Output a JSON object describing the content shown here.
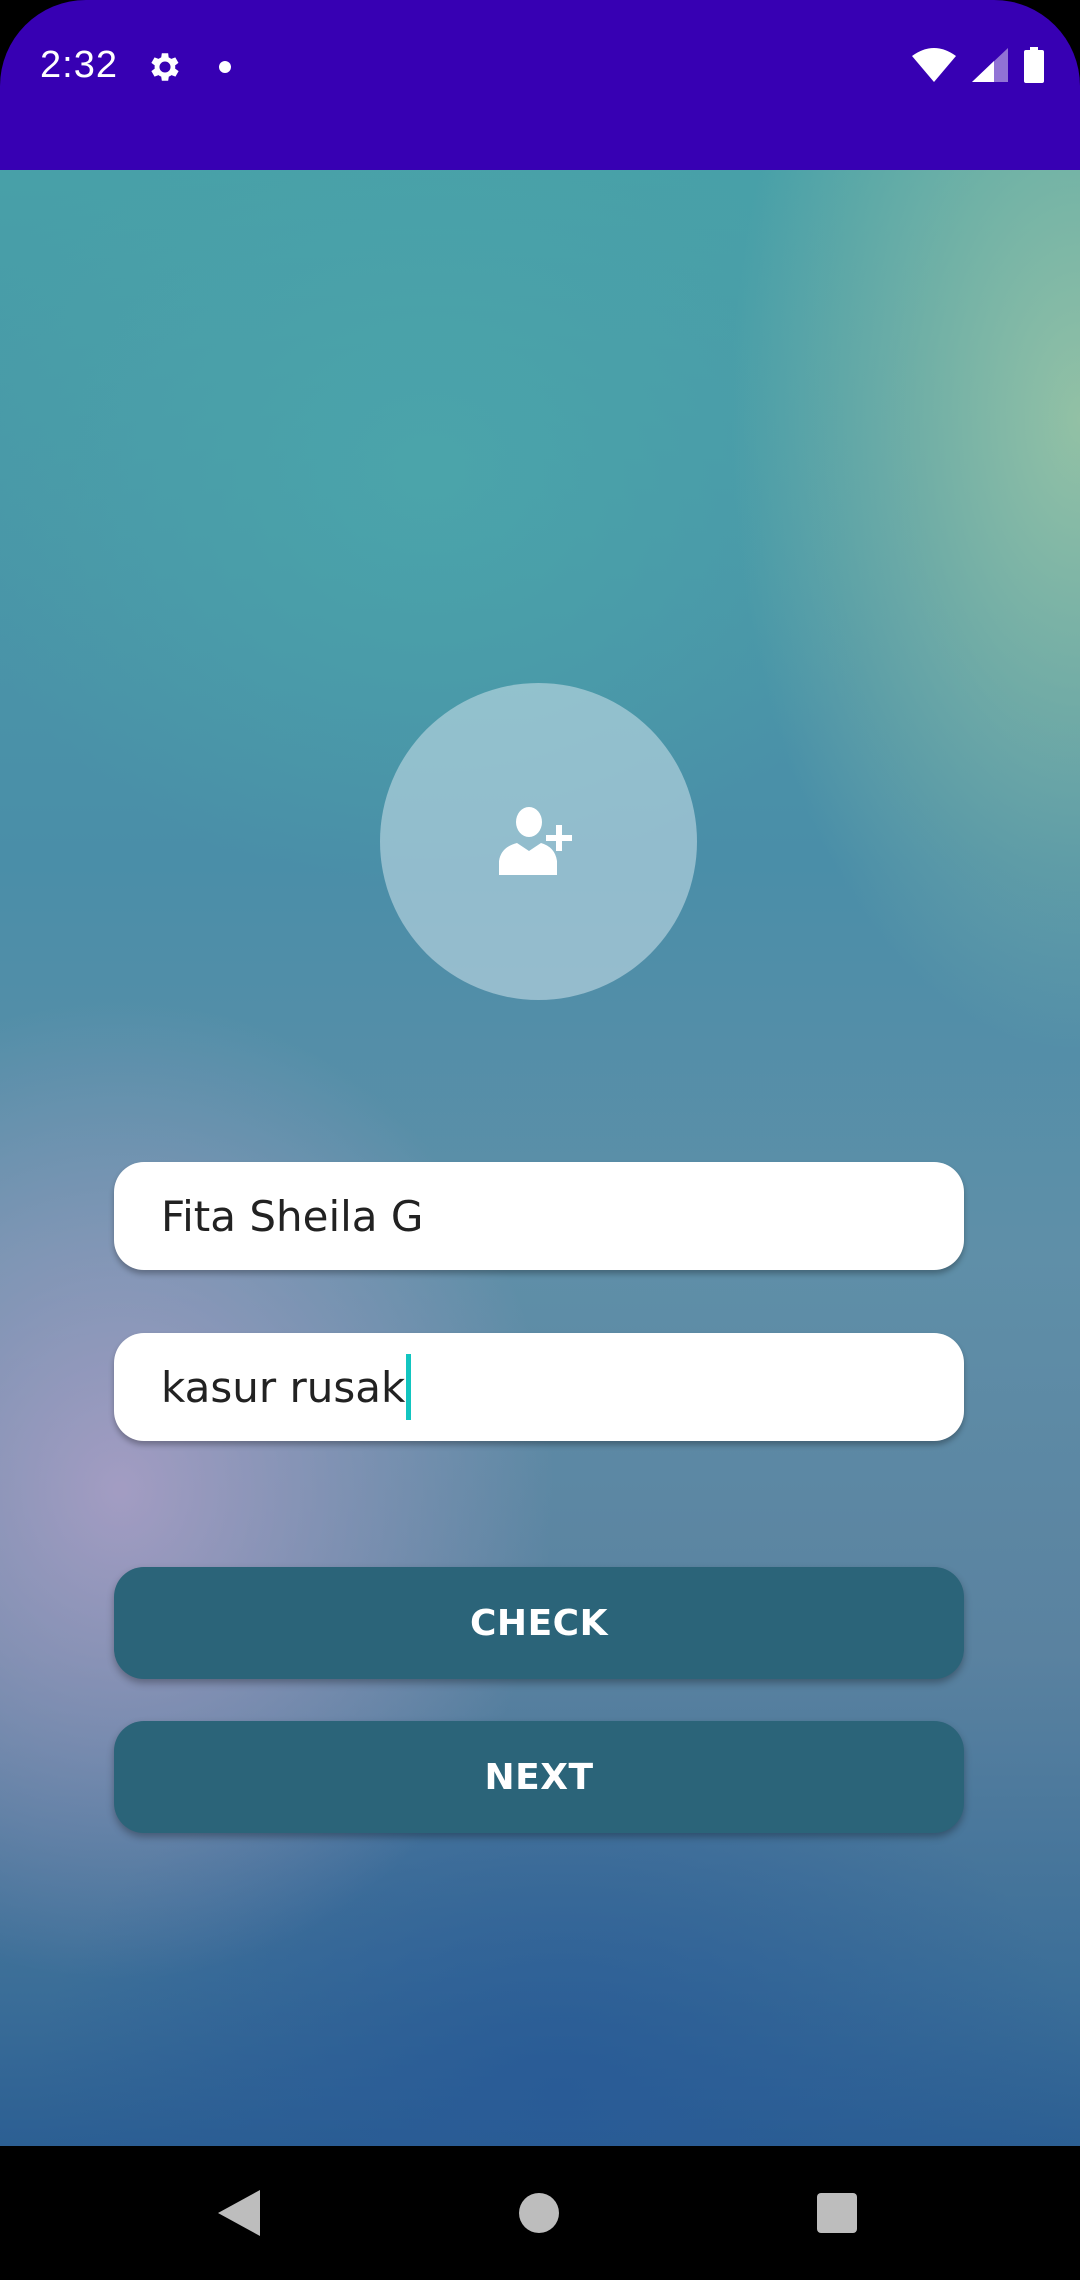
{
  "status_bar": {
    "time": "2:32",
    "icons": [
      "settings-gear-icon",
      "notification-dot-icon",
      "wifi-icon",
      "cell-signal-icon",
      "battery-icon"
    ]
  },
  "profile": {
    "icon": "add-user-icon"
  },
  "form": {
    "name_value": "Fita Sheila G",
    "description_value": "kasur rusak"
  },
  "buttons": {
    "check_label": "CHECK",
    "next_label": "NEXT"
  },
  "navigation": {
    "icons": [
      "back-icon",
      "home-icon",
      "recents-icon"
    ]
  },
  "colors": {
    "status_bar": "#3700b3",
    "button": "#2b6479",
    "caret": "#12c5c0"
  }
}
